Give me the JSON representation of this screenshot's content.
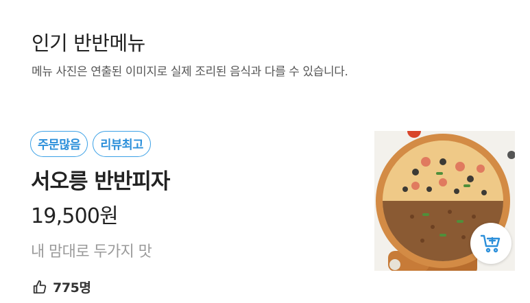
{
  "section": {
    "title": "인기 반반메뉴",
    "note": "메뉴 사진은 연출된 이미지로 실제 조리된 음식과 다를 수 있습니다."
  },
  "item": {
    "badges": [
      "주문많음",
      "리뷰최고"
    ],
    "name": "서오릉 반반피자",
    "price": "19,500원",
    "description": "내 맘대로 두가지 맛",
    "likes": "775명",
    "like_icon": "thumbs-up-icon",
    "cart_icon": "cart-add-icon"
  },
  "colors": {
    "badge_border": "#3aa0e6",
    "badge_text": "#2b8fda",
    "cart_icon": "#2b8fda"
  }
}
